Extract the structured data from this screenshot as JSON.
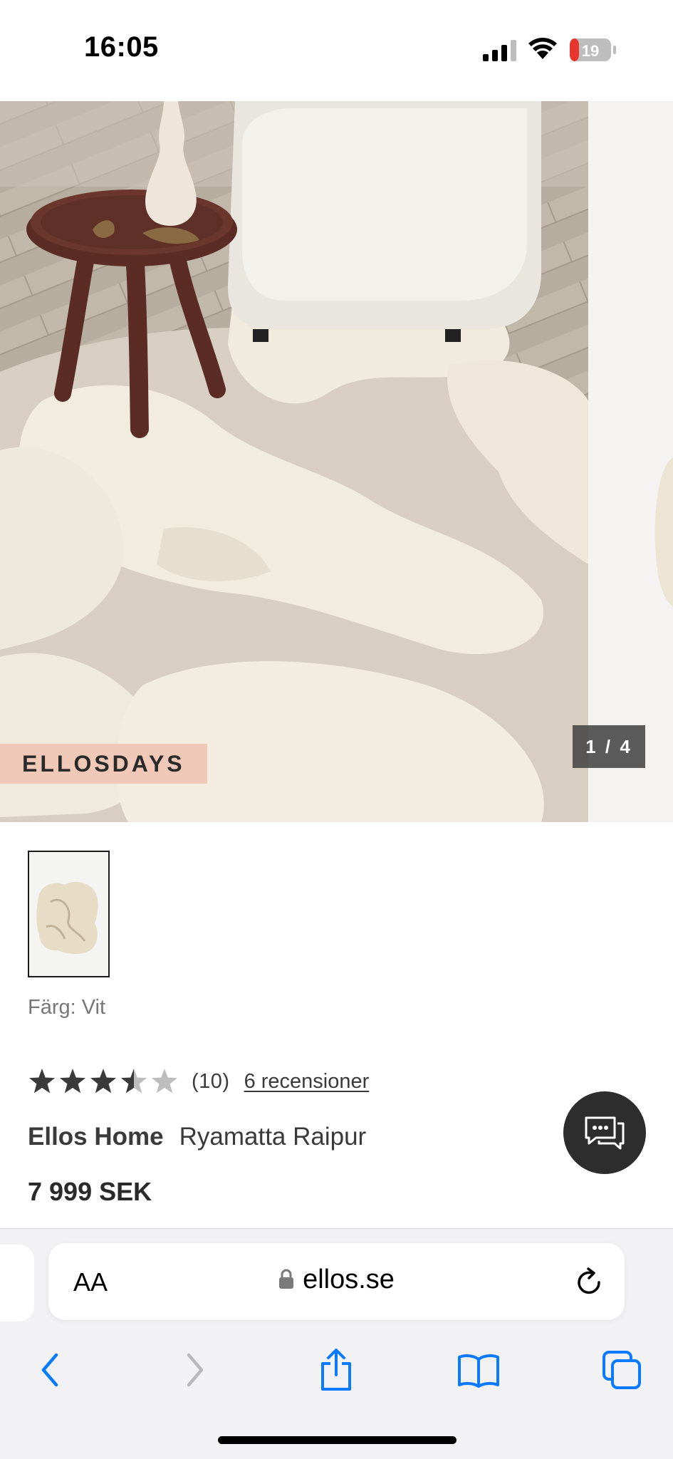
{
  "status_bar": {
    "time": "16:05",
    "battery_level": "19"
  },
  "gallery": {
    "promo_badge": "ELLOSDAYS",
    "counter": "1 / 4"
  },
  "product": {
    "color_label": "Färg: Vit",
    "rating": 3.5,
    "rating_max": 5,
    "rating_count": "(10)",
    "reviews_link": "6 recensioner",
    "brand": "Ellos Home",
    "name": "Ryamatta Raipur",
    "price": "7 999 SEK"
  },
  "browser": {
    "text_size_button": "AA",
    "url": "ellos.se"
  },
  "colors": {
    "promo_badge_bg": "#efc8b7",
    "chat_fab_bg": "#2d2d2d",
    "ios_blue": "#0a7aff",
    "star_filled": "#3a3a3a",
    "star_empty": "#bdbdbd"
  },
  "icons": {
    "signal": "signal-bars-icon",
    "wifi": "wifi-icon",
    "battery": "battery-icon",
    "chat": "chat-bubbles-icon",
    "lock": "lock-icon",
    "reload": "reload-icon",
    "back": "chevron-left-icon",
    "forward": "chevron-right-icon",
    "share": "share-icon",
    "bookmarks": "book-icon",
    "tabs": "tabs-icon"
  }
}
